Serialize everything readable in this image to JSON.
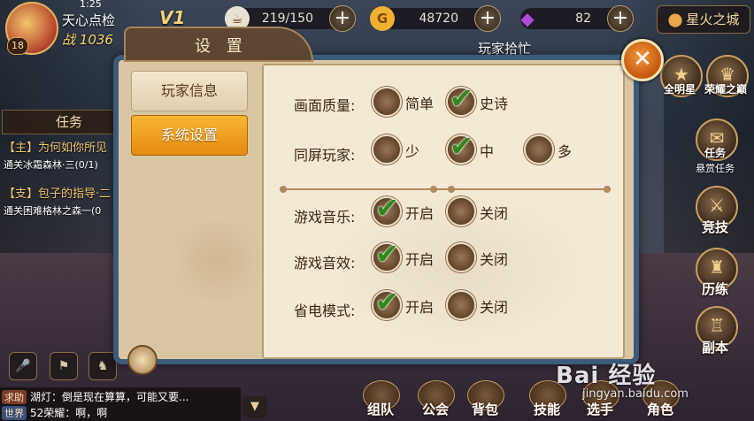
{
  "hud": {
    "player_name": "天心点检",
    "power_label": "战",
    "power_value": "1036",
    "level": "18",
    "vip": "V1",
    "clock": "1:25",
    "stamina": "219/150",
    "gold": "48720",
    "gems": "82",
    "location": "星火之城",
    "top_title": "玩家拾忙"
  },
  "quests": {
    "tab": "任务",
    "items": [
      {
        "title": "【主】为何如你所见",
        "detail": "通关冰霜森林·三(0/1)"
      },
      {
        "title": "【支】包子的指导·二",
        "detail": "通关困难格林之森一(0"
      }
    ]
  },
  "chat": {
    "line1_tag": "求助",
    "line1_text": "湖灯：倒是现在算算，可能又要...",
    "line2_tag": "世界",
    "line2_text": "52荣耀：啊，啊",
    "expand_icon": "chevron-down-icon"
  },
  "bottom_nav": [
    "组队",
    "公会",
    "背包",
    "技能",
    "选手",
    "角色"
  ],
  "right_menu": [
    {
      "label": "全明星",
      "icon": "star-icon"
    },
    {
      "label": "荣耀之巅",
      "icon": "trophy-icon"
    },
    {
      "label": "任务",
      "sub": "悬赏任务",
      "icon": "scroll-icon"
    },
    {
      "label": "竞技",
      "icon": "swords-icon"
    },
    {
      "label": "历练",
      "icon": "helmet-icon"
    },
    {
      "label": "副本",
      "icon": "castle-icon"
    }
  ],
  "dialog": {
    "title": "设 置",
    "tabs": {
      "player_info": "玩家信息",
      "system_settings": "系统设置"
    },
    "settings": {
      "quality": {
        "label": "画面质量:",
        "options": [
          "简单",
          "史诗"
        ],
        "selected": "史诗"
      },
      "players": {
        "label": "同屏玩家:",
        "options": [
          "少",
          "中",
          "多"
        ],
        "selected": "中"
      },
      "music": {
        "label": "游戏音乐:",
        "options": [
          "开启",
          "关闭"
        ],
        "selected": "开启"
      },
      "sound": {
        "label": "游戏音效:",
        "options": [
          "开启",
          "关闭"
        ],
        "selected": "开启"
      },
      "power_save": {
        "label": "省电模式:",
        "options": [
          "开启",
          "关闭"
        ],
        "selected": "开启"
      }
    },
    "close_icon": "close-icon"
  },
  "watermark": {
    "logo": "Bai 经验",
    "url": "jingyan.baidu.com"
  },
  "colors": {
    "accent_orange": "#f7b533",
    "check_green": "#2f8a1c",
    "dialog_frame": "#3c5b7a",
    "panel_bg": "#f3e9d5"
  }
}
